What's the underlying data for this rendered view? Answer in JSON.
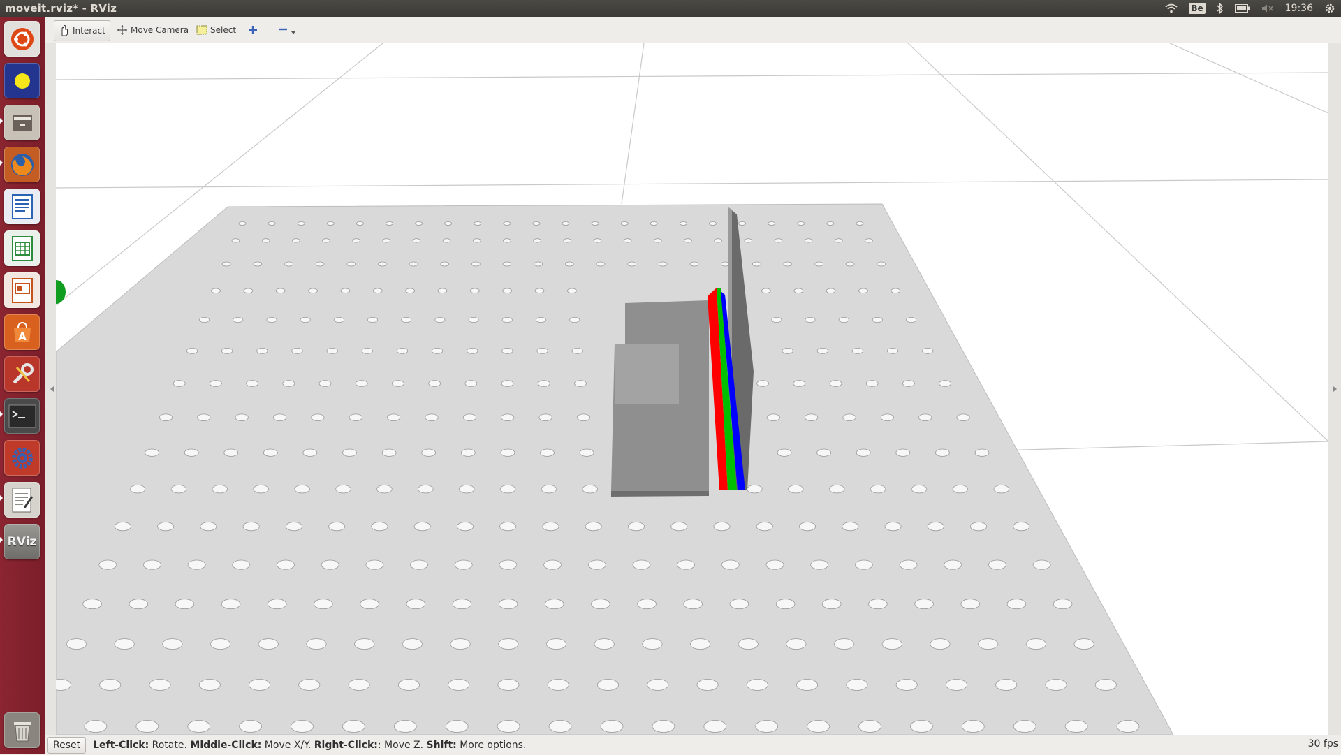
{
  "window": {
    "title": "moveit.rviz* - RViz"
  },
  "tray": {
    "keyboard_layout": "Be",
    "clock": "19:36"
  },
  "launcher": {
    "items": [
      {
        "name": "ubuntu-dash",
        "color": "#d8531e"
      },
      {
        "name": "system-settings-light",
        "color": "#2a3f9e"
      },
      {
        "name": "files",
        "color": "#7a6f63"
      },
      {
        "name": "firefox",
        "color": "#e3751a"
      },
      {
        "name": "libreoffice-writer",
        "color": "#2a63b3"
      },
      {
        "name": "libreoffice-calc",
        "color": "#2d8d3c"
      },
      {
        "name": "libreoffice-impress",
        "color": "#c2541b"
      },
      {
        "name": "software-center",
        "color": "#e07b2a"
      },
      {
        "name": "system-tools",
        "color": "#b33a2e"
      },
      {
        "name": "terminal",
        "color": "#3a3a3a"
      },
      {
        "name": "settings-gear",
        "color": "#b8412f"
      },
      {
        "name": "text-editor",
        "color": "#6a6760"
      },
      {
        "name": "rviz",
        "label": "RViz",
        "color": "#7a7874"
      },
      {
        "name": "trash",
        "color": "#8a8680"
      }
    ]
  },
  "toolbar": {
    "interact_label": "Interact",
    "move_camera_label": "Move Camera",
    "select_label": "Select"
  },
  "status": {
    "reset_label": "Reset",
    "hint_left_key": "Left-Click:",
    "hint_left_val": " Rotate. ",
    "hint_middle_key": "Middle-Click:",
    "hint_middle_val": " Move X/Y. ",
    "hint_right_key": "Right-Click:",
    "hint_right_val": ": Move Z. ",
    "hint_shift_key": "Shift:",
    "hint_shift_val": " More options.",
    "fps": "30 fps"
  },
  "colors": {
    "launcher_bg": "#7b1e2a",
    "axis_x": "#ff0000",
    "axis_y": "#00c000",
    "axis_z": "#0000ff",
    "plate": "#d9d9d9",
    "object": "#8c8c8c"
  }
}
